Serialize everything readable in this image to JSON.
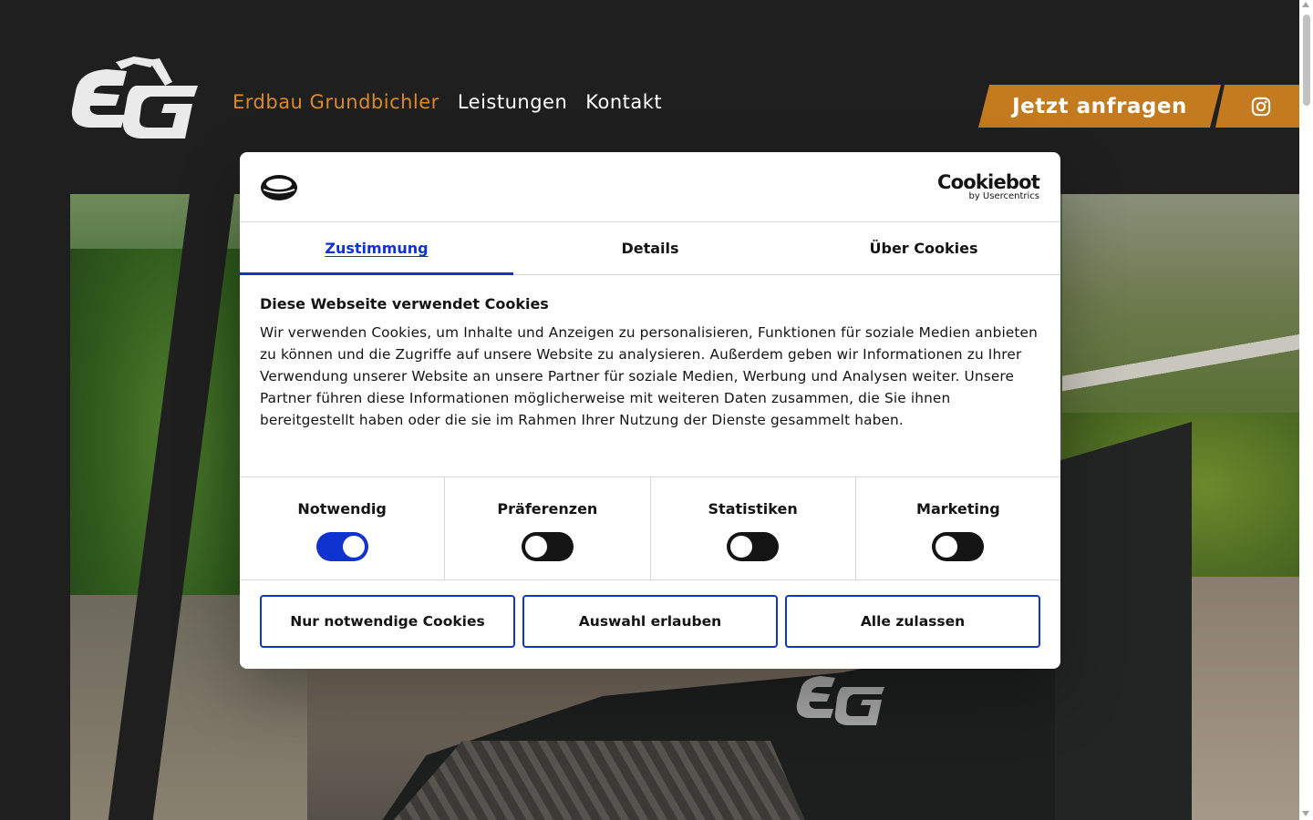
{
  "header": {
    "nav": [
      {
        "label": "Erdbau Grundbichler",
        "active": true
      },
      {
        "label": "Leistungen",
        "active": false
      },
      {
        "label": "Kontakt",
        "active": false
      }
    ],
    "cta_label": "Jetzt anfragen",
    "social_icon": "instagram-icon"
  },
  "colors": {
    "background": "#1f1f1f",
    "accent": "#c47a1e",
    "nav_active": "#d98a2b",
    "cookie_accent": "#1032cf"
  },
  "cookie_dialog": {
    "brand": "Cookiebot",
    "brand_sub": "by Usercentrics",
    "tabs": [
      {
        "label": "Zustimmung",
        "active": true
      },
      {
        "label": "Details",
        "active": false
      },
      {
        "label": "Über Cookies",
        "active": false
      }
    ],
    "heading": "Diese Webseite verwendet Cookies",
    "text": "Wir verwenden Cookies, um Inhalte und Anzeigen zu personalisieren, Funktionen für soziale Medien anbieten zu können und die Zugriffe auf unsere Website zu analysieren. Außerdem geben wir Informationen zu Ihrer Verwendung unserer Website an unsere Partner für soziale Medien, Werbung und Analysen weiter. Unsere Partner führen diese Informationen möglicherweise mit weiteren Daten zusammen, die Sie ihnen bereitgestellt haben oder die sie im Rahmen Ihrer Nutzung der Dienste gesammelt haben.",
    "toggles": [
      {
        "label": "Notwendig",
        "on": true
      },
      {
        "label": "Präferenzen",
        "on": false
      },
      {
        "label": "Statistiken",
        "on": false
      },
      {
        "label": "Marketing",
        "on": false
      }
    ],
    "buttons": [
      {
        "label": "Nur notwendige Cookies"
      },
      {
        "label": "Auswahl erlauben"
      },
      {
        "label": "Alle zulassen"
      }
    ]
  }
}
